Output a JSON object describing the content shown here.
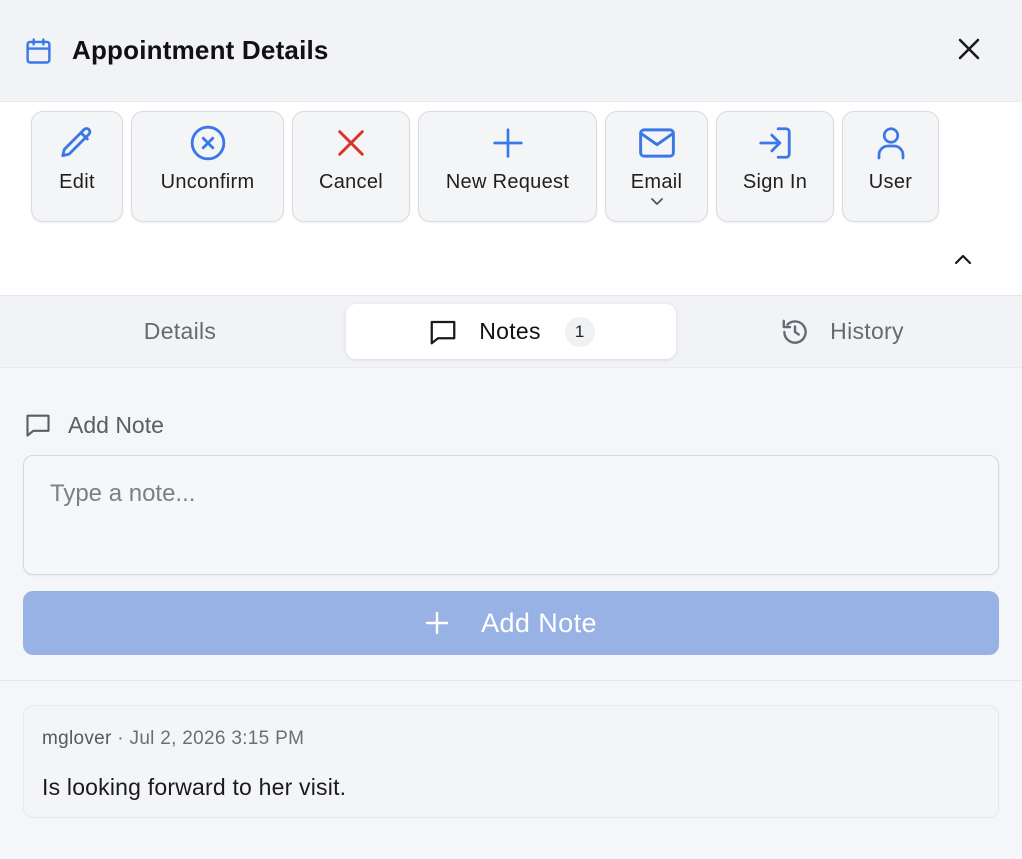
{
  "header": {
    "title": "Appointment Details",
    "icon": "calendar-icon",
    "close_icon": "close-icon"
  },
  "toolbar": {
    "buttons": [
      {
        "label": "Edit",
        "icon": "pencil-icon"
      },
      {
        "label": "Unconfirm",
        "icon": "x-circle-icon"
      },
      {
        "label": "Cancel",
        "icon": "x-icon"
      },
      {
        "label": "New Request",
        "icon": "plus-icon"
      },
      {
        "label": "Email",
        "icon": "mail-icon"
      },
      {
        "label": "Sign In",
        "icon": "sign-in-icon"
      },
      {
        "label": "User",
        "icon": "user-icon"
      }
    ]
  },
  "tabs": {
    "details": "Details",
    "notes": "Notes",
    "notes_count": "1",
    "history": "History",
    "active": "notes"
  },
  "add_note": {
    "label": "Add Note",
    "placeholder": "Type a note...",
    "button_label": "Add Note"
  },
  "notes": [
    {
      "author": "mglover",
      "separator": "·",
      "timestamp": "Jul 2, 2026 3:15 PM",
      "text": "Is looking forward to her visit."
    }
  ],
  "colors": {
    "accent_blue": "#3b78e7",
    "cancel_red": "#d9342b",
    "add_button_bg": "#99b2e6"
  }
}
